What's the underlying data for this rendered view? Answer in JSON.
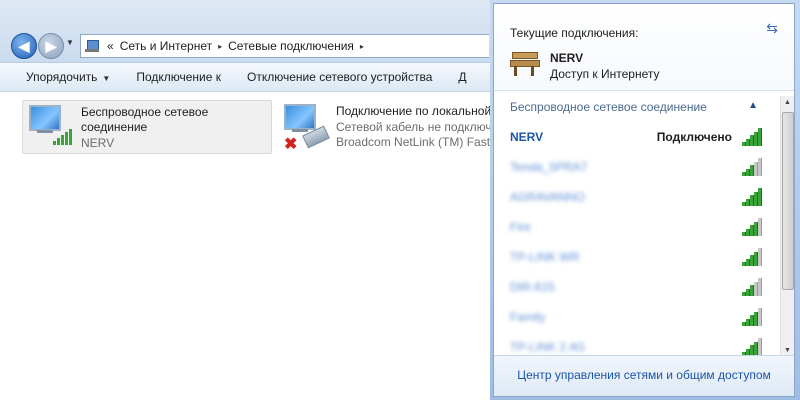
{
  "explorer": {
    "breadcrumb": {
      "overflow": "«",
      "parts": [
        "Сеть и Интернет",
        "Сетевые подключения"
      ],
      "separator": "▸"
    },
    "commands": {
      "organize": "Упорядочить",
      "connect_to": "Подключение к",
      "disable_device": "Отключение сетевого устройства",
      "diag": "Д"
    },
    "adapters": [
      {
        "name_line1": "Беспроводное сетевое",
        "name_line2": "соединение",
        "detail": "NERV",
        "signal_bars": 5,
        "selected": true
      },
      {
        "name": "Подключение по локальной сети",
        "detail_line1": "Сетевой кабель не подключен",
        "detail_line2": "Broadcom NetLink (TM) Fast Ethernet",
        "status_icon": "red-x-icon"
      }
    ]
  },
  "flyout": {
    "title": "Текущие подключения:",
    "refresh_icon": "refresh-icon",
    "current": {
      "name": "NERV",
      "status": "Доступ к Интернету",
      "icon": "bench-icon"
    },
    "section_title": "Беспроводное сетевое соединение",
    "networks": [
      {
        "name": "NERV",
        "state": "Подключено",
        "strength": 5,
        "connected": true
      },
      {
        "name": "Tenda_5PRA7",
        "state": "",
        "strength": 3,
        "obscured": true
      },
      {
        "name": "AGRAVANNO",
        "state": "",
        "strength": 5,
        "obscured": true
      },
      {
        "name": "Fire",
        "state": "",
        "strength": 4,
        "obscured": true
      },
      {
        "name": "TP-LINK WR",
        "state": "",
        "strength": 4,
        "obscured": true
      },
      {
        "name": "DIR-615",
        "state": "",
        "strength": 3,
        "obscured": true
      },
      {
        "name": "Family",
        "state": "",
        "strength": 4,
        "obscured": true
      },
      {
        "name": "TP-LINK 2.4G",
        "state": "",
        "strength": 4,
        "obscured": true
      }
    ],
    "footer_link": "Центр управления сетями и общим доступом"
  },
  "colors": {
    "link_blue": "#1b55a8",
    "signal_green": "#3aa33a",
    "error_red": "#d4231c"
  }
}
